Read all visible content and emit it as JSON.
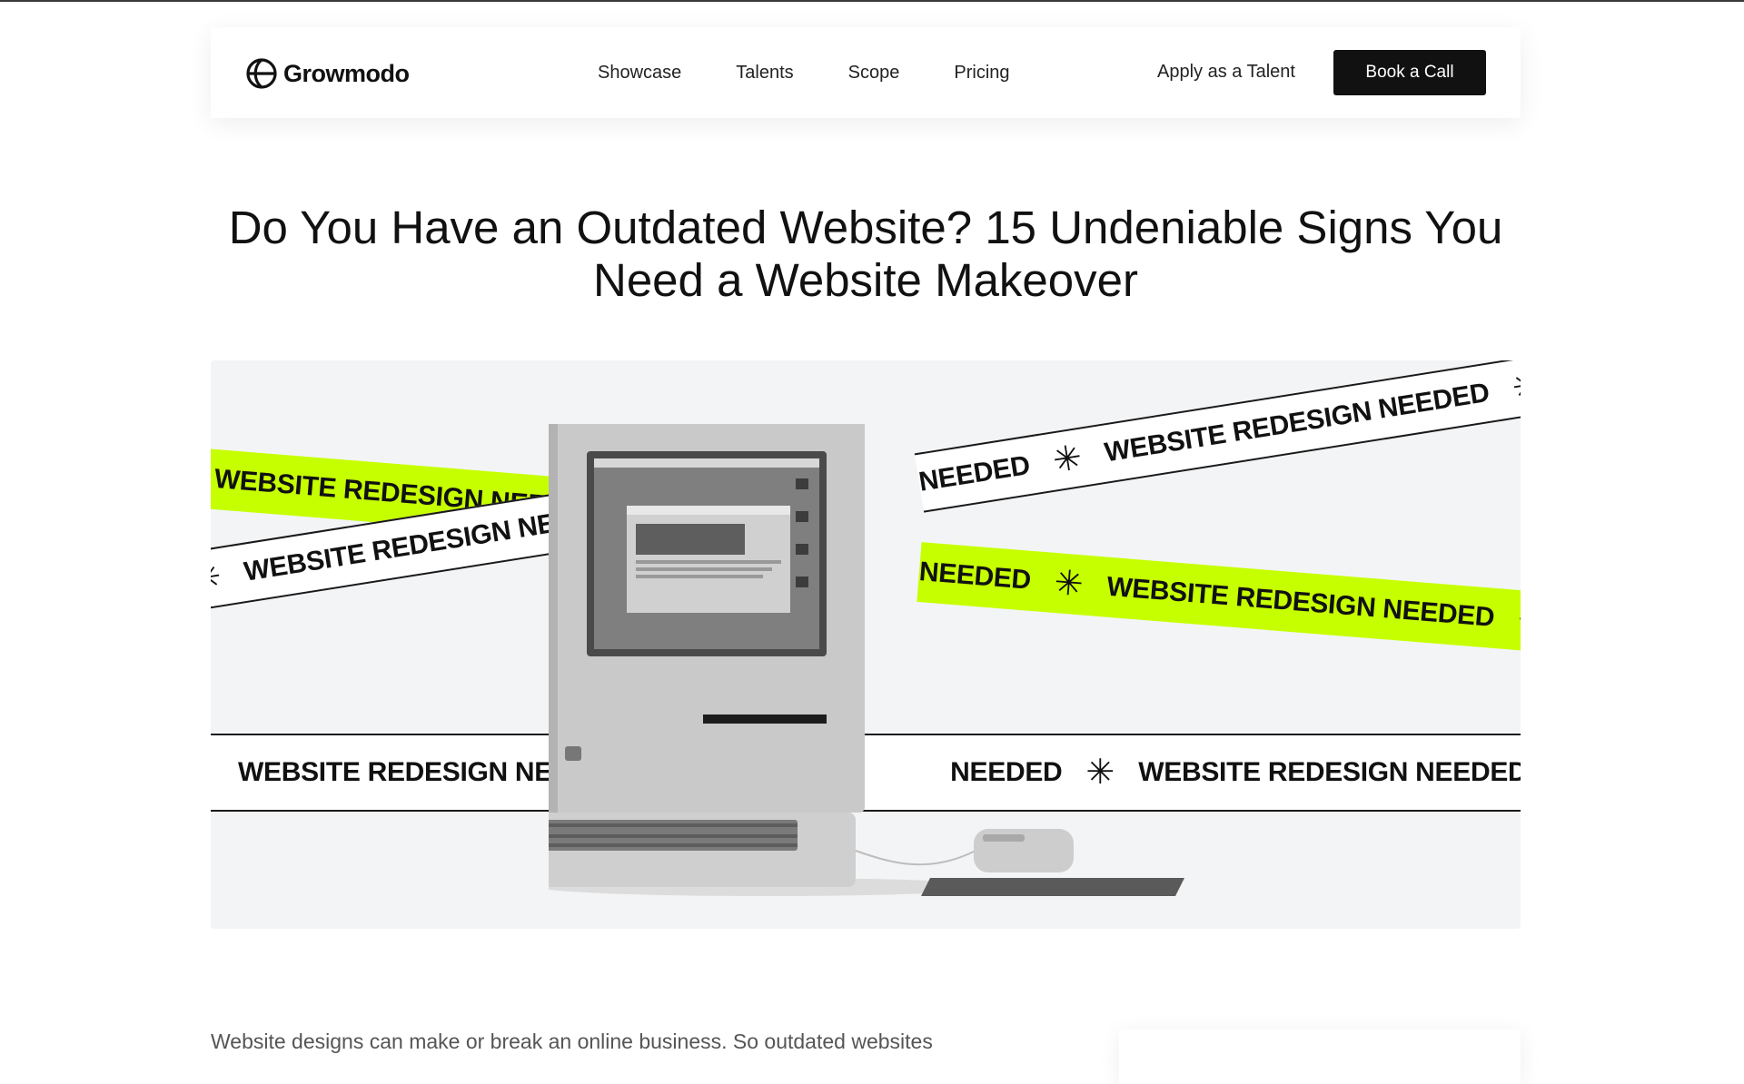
{
  "brand": {
    "name": "Growmodo",
    "logo_icon": "growmodo-logo-icon"
  },
  "nav": {
    "links": [
      "Showcase",
      "Talents",
      "Scope",
      "Pricing"
    ],
    "apply_label": "Apply as a Talent",
    "cta_label": "Book a Call"
  },
  "article": {
    "title": "Do You Have an Outdated Website? 15 Undeniable Signs You Need a Website Makeover",
    "intro": "Website designs can make or break an online business. So outdated websites"
  },
  "hero": {
    "tape_text": "WEBSITE REDESIGN NEEDED",
    "tape_partial": "NEEDED",
    "accent_color": "#c6ff00"
  },
  "colors": {
    "cta_bg": "#111111",
    "hero_bg": "#f3f4f6"
  }
}
